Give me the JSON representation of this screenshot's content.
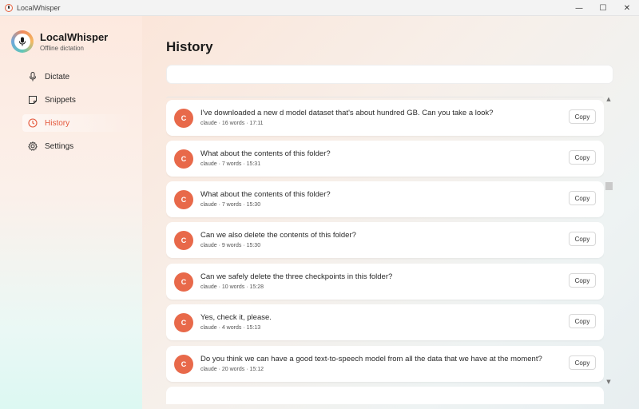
{
  "window": {
    "title": "LocalWhisper",
    "controls": {
      "minimize": "—",
      "maximize": "☐",
      "close": "✕"
    }
  },
  "brand": {
    "name": "LocalWhisper",
    "tagline": "Offline dictation",
    "logo_icon": "microphone-icon"
  },
  "nav": {
    "items": [
      {
        "label": "Dictate",
        "icon": "microphone-icon",
        "active": false
      },
      {
        "label": "Snippets",
        "icon": "note-icon",
        "active": false
      },
      {
        "label": "History",
        "icon": "clock-icon",
        "active": true
      },
      {
        "label": "Settings",
        "icon": "gear-icon",
        "active": false
      }
    ]
  },
  "colors": {
    "accent": "#e4573a",
    "avatar": "#e8694a"
  },
  "main": {
    "title": "History",
    "search": {
      "value": "",
      "placeholder": ""
    },
    "copy_label": "Copy",
    "scroll_up": "▲",
    "scroll_down": "▼",
    "entries": [
      {
        "avatar": "C",
        "text": "I've downloaded a new d model dataset that's about hundred GB. Can you take a look?",
        "meta": "claude · 16 words · 17:11"
      },
      {
        "avatar": "C",
        "text": "What about the contents of this folder?",
        "meta": "claude · 7 words · 15:31"
      },
      {
        "avatar": "C",
        "text": "What about the contents of this folder?",
        "meta": "claude · 7 words · 15:30"
      },
      {
        "avatar": "C",
        "text": "Can we also delete the contents of this folder?",
        "meta": "claude · 9 words · 15:30"
      },
      {
        "avatar": "C",
        "text": "Can we safely delete the three checkpoints in this folder?",
        "meta": "claude · 10 words · 15:28"
      },
      {
        "avatar": "C",
        "text": "Yes, check it, please.",
        "meta": "claude · 4 words · 15:13"
      },
      {
        "avatar": "C",
        "text": "Do you think we can have a good text-to-speech model from all the data that we have at the moment?",
        "meta": "claude · 20 words · 15:12"
      }
    ]
  }
}
